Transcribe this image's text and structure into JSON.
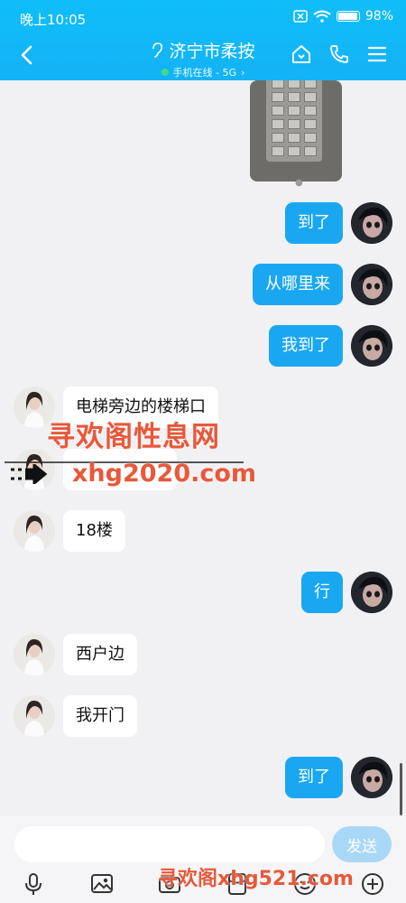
{
  "status_bar": {
    "time": "晚上10:05",
    "battery": "98%"
  },
  "header": {
    "title": "济宁市柔按",
    "subtitle": "手机在线 - 5G"
  },
  "messages": [
    {
      "side": "me",
      "text": "到了"
    },
    {
      "side": "me",
      "text": "从哪里来"
    },
    {
      "side": "me",
      "text": "我到了"
    },
    {
      "side": "them",
      "text": "电梯旁边的楼梯口"
    },
    {
      "side": "them",
      "text": ""
    },
    {
      "side": "them",
      "text": "18楼"
    },
    {
      "side": "me",
      "text": "行"
    },
    {
      "side": "them",
      "text": "西户边"
    },
    {
      "side": "them",
      "text": "我开门"
    },
    {
      "side": "me",
      "text": "到了"
    }
  ],
  "watermarks": {
    "site_name": "寻欢阁性息网",
    "site_url": "xhg2020.com",
    "footer": "寻欢阁xhg521.com"
  },
  "input": {
    "value": "",
    "send_label": "发送"
  },
  "colors": {
    "header": "#14b2f6",
    "bubble_me": "#1aa7f2",
    "watermark": "#e8583a"
  }
}
